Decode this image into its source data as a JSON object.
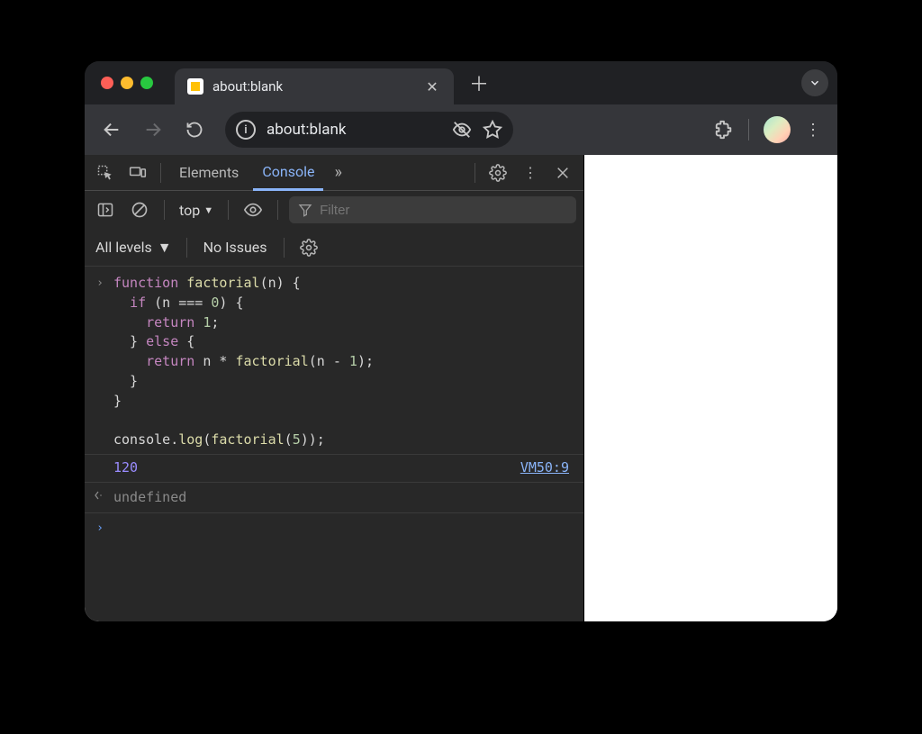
{
  "tab": {
    "title": "about:blank"
  },
  "omnibox": {
    "url": "about:blank"
  },
  "devtools": {
    "tabs": {
      "elements": "Elements",
      "console": "Console"
    },
    "console_toolbar": {
      "context": "top",
      "filter_placeholder": "Filter",
      "levels": "All levels",
      "issues": "No Issues"
    },
    "console": {
      "input_code": "function factorial(n) {\n  if (n === 0) {\n    return 1;\n  } else {\n    return n * factorial(n - 1);\n  }\n}\n\nconsole.log(factorial(5));",
      "log_value": "120",
      "log_source": "VM50:9",
      "return_value": "undefined"
    }
  }
}
